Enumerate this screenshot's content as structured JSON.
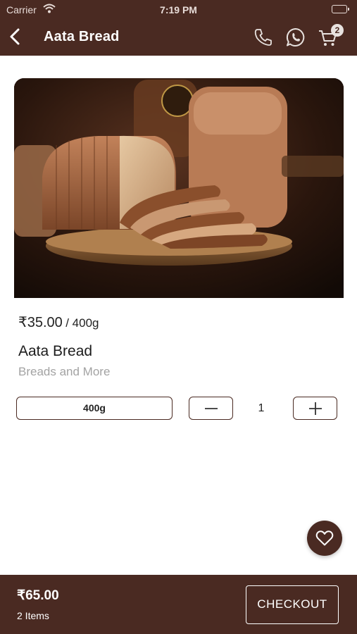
{
  "status_bar": {
    "carrier": "Carrier",
    "time": "7:19 PM"
  },
  "header": {
    "title": "Aata Bread",
    "cart_count": "2"
  },
  "product": {
    "image_icon": "bread-photo",
    "price": "₹35.00",
    "unit": "/ 400g",
    "name": "Aata Bread",
    "category": "Breads and More",
    "variant": "400g",
    "quantity": "1"
  },
  "footer": {
    "total": "₹65.00",
    "items": "2 Items",
    "checkout_label": "CHECKOUT"
  },
  "colors": {
    "brand": "#4a2a22",
    "muted_text": "#a3a3a3",
    "background": "#ffffff"
  }
}
